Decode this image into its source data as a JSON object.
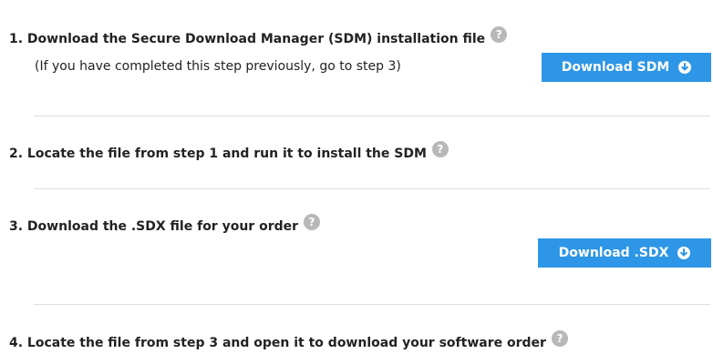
{
  "steps": [
    {
      "text": "1. Download the Secure Download Manager (SDM) installation file",
      "help": "?"
    },
    {
      "text": "2. Locate the file from step 1 and run it to install the SDM",
      "help": "?"
    },
    {
      "text": "3. Download the .SDX file for your order",
      "help": "?"
    },
    {
      "text": "4. Locate the file from step 3 and open it to download your software order",
      "help": "?"
    }
  ],
  "step1_note": "(If you have completed this step previously, go to step 3)",
  "buttons": {
    "download_sdm": "Download SDM",
    "download_sdx": "Download .SDX"
  },
  "colors": {
    "button_bg": "#2d96e6",
    "help_icon": "#b8b8b8",
    "divider": "#dddddd"
  },
  "icons": {
    "help": "question-circle-icon",
    "download": "arrow-down-circle-icon"
  }
}
